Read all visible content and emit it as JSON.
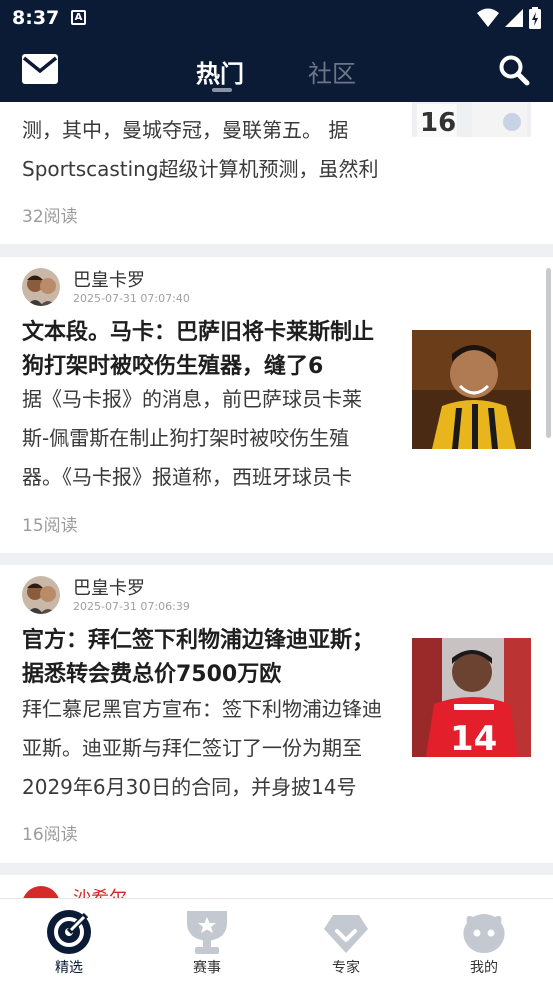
{
  "status_bar": {
    "time": "8:37",
    "notification_icon": "A"
  },
  "header": {
    "tabs": [
      {
        "label": "热门",
        "active": true
      },
      {
        "label": "社区",
        "active": false
      }
    ],
    "colors": {
      "bar": "#0b1b36"
    }
  },
  "feed": {
    "partial_card": {
      "body": "测，其中，曼城夺冠，曼联第五。 据Sportscasting超级计算机预测，虽然利",
      "reads": "32阅读"
    },
    "cards": [
      {
        "author": "巴皇卡罗",
        "time": "2025-07-31 07:07:40",
        "title": "文本段。马卡：巴萨旧将卡莱斯制止狗打架时被咬伤生殖器，缝了6",
        "body": "据《马卡报》的消息，前巴萨球员卡莱斯-佩雷斯在制止狗打架时被咬伤生殖器。《马卡报》报道称，西班牙球员卡",
        "reads": "15阅读"
      },
      {
        "author": "巴皇卡罗",
        "time": "2025-07-31 07:06:39",
        "title": "官方：拜仁签下利物浦边锋迪亚斯；据悉转会费总价7500万欧",
        "body": "拜仁慕尼黑官方宣布：签下利物浦边锋迪亚斯。迪亚斯与拜仁签订了一份为期至2029年6月30日的合同，并身披14号",
        "reads": "16阅读"
      }
    ],
    "next_card_author": "沙希尔"
  },
  "bottom_nav": [
    {
      "label": "精选",
      "icon": "target-icon",
      "active": true
    },
    {
      "label": "赛事",
      "icon": "trophy-icon",
      "active": false
    },
    {
      "label": "专家",
      "icon": "diamond-icon",
      "active": false
    },
    {
      "label": "我的",
      "icon": "face-icon",
      "active": false
    }
  ]
}
